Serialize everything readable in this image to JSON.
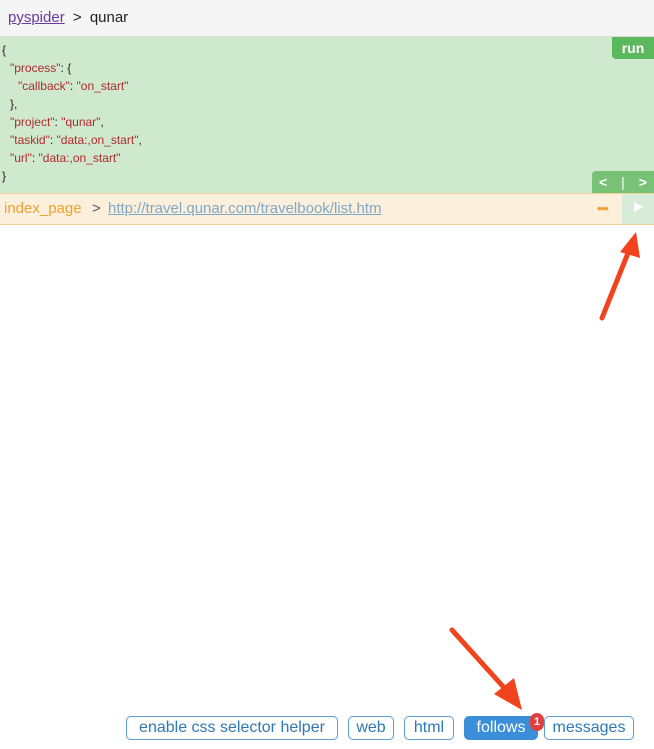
{
  "header": {
    "link": "pyspider",
    "separator": ">",
    "project": "qunar"
  },
  "task": {
    "lines": [
      {
        "indent": 0,
        "text": "{"
      },
      {
        "indent": 1,
        "key": "\"process\"",
        "rest": ": {"
      },
      {
        "indent": 2,
        "key": "\"callback\"",
        "mid": ": ",
        "val": "\"on_start\""
      },
      {
        "indent": 1,
        "text": "},"
      },
      {
        "indent": 1,
        "key": "\"project\"",
        "mid": ": ",
        "val": "\"qunar\"",
        "tail": ","
      },
      {
        "indent": 1,
        "key": "\"taskid\"",
        "mid": ": ",
        "val": "\"data:,on_start\"",
        "tail": ","
      },
      {
        "indent": 1,
        "key": "\"url\"",
        "mid": ": ",
        "val": "\"data:,on_start\""
      },
      {
        "indent": 0,
        "text": "}"
      }
    ],
    "run_label": "run",
    "nav_prev": "<",
    "nav_divider": "|",
    "nav_next": ">"
  },
  "url_bar": {
    "callback": "index_page",
    "separator": ">",
    "url": "http://travel.qunar.com/travelbook/list.htm",
    "more": "•••",
    "play_icon": "play-icon"
  },
  "tabs": {
    "css_helper": "enable css selector helper",
    "web": "web",
    "html": "html",
    "follows": "follows",
    "follows_badge": "1",
    "messages": "messages"
  },
  "colors": {
    "task_bg": "#cfe9cf",
    "run_btn": "#5cb85c",
    "url_bar_bg": "#fcf0dd",
    "callback": "#f0a030",
    "tab_border": "#5b9ecf",
    "tab_active": "#3a8fd8",
    "badge": "#e04040",
    "annotation_arrow": "#f0431e"
  }
}
